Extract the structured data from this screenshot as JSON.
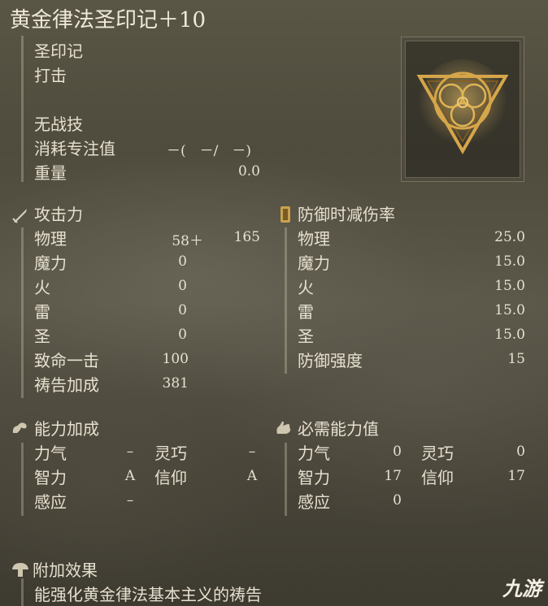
{
  "item": {
    "title": "黄金律法圣印记＋10",
    "type": "圣印记",
    "attack_type": "打击",
    "skill": "无战技",
    "fp_cost_label": "消耗专注值",
    "fp_cost_value": "－(　－/　－)",
    "weight_label": "重量",
    "weight_value": "0.0"
  },
  "attack": {
    "header": "攻击力",
    "rows": [
      {
        "label": "物理",
        "value": "58＋",
        "extra": "165"
      },
      {
        "label": "魔力",
        "value": "0"
      },
      {
        "label": "火",
        "value": "0"
      },
      {
        "label": "雷",
        "value": "0"
      },
      {
        "label": "圣",
        "value": "0"
      },
      {
        "label": "致命一击",
        "value": "100"
      },
      {
        "label": "祷告加成",
        "value": "381"
      }
    ]
  },
  "defense": {
    "header": "防御时减伤率",
    "rows": [
      {
        "label": "物理",
        "value": "25.0"
      },
      {
        "label": "魔力",
        "value": "15.0"
      },
      {
        "label": "火",
        "value": "15.0"
      },
      {
        "label": "雷",
        "value": "15.0"
      },
      {
        "label": "圣",
        "value": "15.0"
      },
      {
        "label": "防御强度",
        "value": "15"
      }
    ]
  },
  "scaling": {
    "header": "能力加成",
    "rows": [
      {
        "label": "力气",
        "value": "–",
        "label2": "灵巧",
        "value2": "–"
      },
      {
        "label": "智力",
        "value": "A",
        "label2": "信仰",
        "value2": "A"
      },
      {
        "label": "感应",
        "value": "–"
      }
    ]
  },
  "requirements": {
    "header": "必需能力值",
    "rows": [
      {
        "label": "力气",
        "value": "0",
        "label2": "灵巧",
        "value2": "0"
      },
      {
        "label": "智力",
        "value": "17",
        "label2": "信仰",
        "value2": "17"
      },
      {
        "label": "感应",
        "value": "0"
      }
    ]
  },
  "effect": {
    "header": "附加效果",
    "text": "能强化黄金律法基本主义的祷告"
  },
  "watermark": "九游",
  "colors": {
    "text": "#e7e0cf",
    "emblem_gold": "#d6a64a"
  }
}
